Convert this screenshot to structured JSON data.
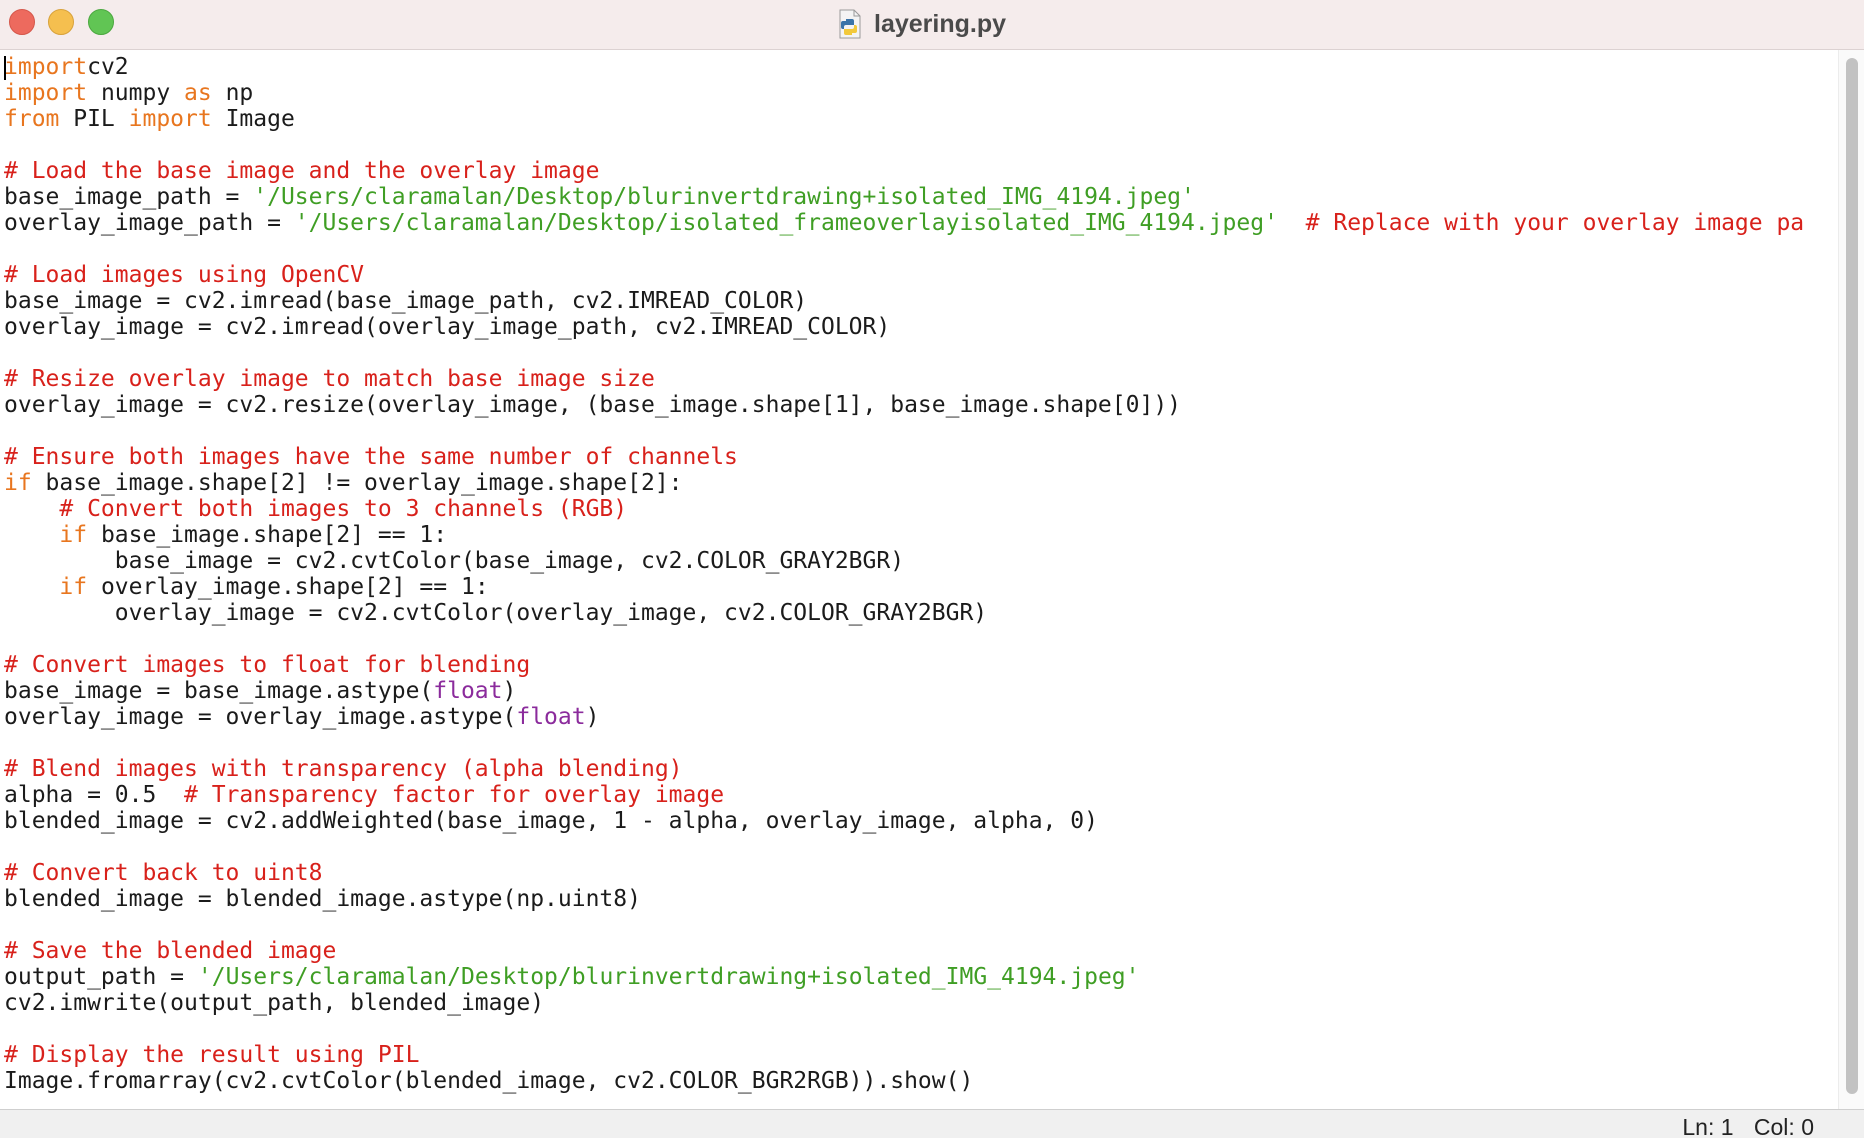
{
  "window": {
    "title": "layering.py",
    "file_icon": "python-file-icon"
  },
  "editor": {
    "lines": [
      [
        [
          "kw",
          "import"
        ],
        [
          "",
          "cv2"
        ]
      ],
      [
        [
          "kw",
          "import"
        ],
        [
          "",
          " numpy "
        ],
        [
          "kw",
          "as"
        ],
        [
          "",
          " np"
        ]
      ],
      [
        [
          "kw",
          "from"
        ],
        [
          "",
          " PIL "
        ],
        [
          "kw",
          "import"
        ],
        [
          "",
          " Image"
        ]
      ],
      [],
      [
        [
          "cm",
          "# Load the base image and the overlay image"
        ]
      ],
      [
        [
          "",
          "base_image_path = "
        ],
        [
          "st",
          "'/Users/claramalan/Desktop/blurinvertdrawing+isolated_IMG_4194.jpeg'"
        ]
      ],
      [
        [
          "",
          "overlay_image_path = "
        ],
        [
          "st",
          "'/Users/claramalan/Desktop/isolated_frameoverlayisolated_IMG_4194.jpeg'"
        ],
        [
          "",
          "  "
        ],
        [
          "cm",
          "# Replace with your overlay image pa"
        ]
      ],
      [],
      [
        [
          "cm",
          "# Load images using OpenCV"
        ]
      ],
      [
        [
          "",
          "base_image = cv2.imread(base_image_path, cv2.IMREAD_COLOR)"
        ]
      ],
      [
        [
          "",
          "overlay_image = cv2.imread(overlay_image_path, cv2.IMREAD_COLOR)"
        ]
      ],
      [],
      [
        [
          "cm",
          "# Resize overlay image to match base image size"
        ]
      ],
      [
        [
          "",
          "overlay_image = cv2.resize(overlay_image, (base_image.shape[1], base_image.shape[0]))"
        ]
      ],
      [],
      [
        [
          "cm",
          "# Ensure both images have the same number of channels"
        ]
      ],
      [
        [
          "kw",
          "if"
        ],
        [
          "",
          " base_image.shape[2] != overlay_image.shape[2]:"
        ]
      ],
      [
        [
          "",
          "    "
        ],
        [
          "cm",
          "# Convert both images to 3 channels (RGB)"
        ]
      ],
      [
        [
          "",
          "    "
        ],
        [
          "kw",
          "if"
        ],
        [
          "",
          " base_image.shape[2] == 1:"
        ]
      ],
      [
        [
          "",
          "        base_image = cv2.cvtColor(base_image, cv2.COLOR_GRAY2BGR)"
        ]
      ],
      [
        [
          "",
          "    "
        ],
        [
          "kw",
          "if"
        ],
        [
          "",
          " overlay_image.shape[2] == 1:"
        ]
      ],
      [
        [
          "",
          "        overlay_image = cv2.cvtColor(overlay_image, cv2.COLOR_GRAY2BGR)"
        ]
      ],
      [],
      [
        [
          "cm",
          "# Convert images to float for blending"
        ]
      ],
      [
        [
          "",
          "base_image = base_image.astype("
        ],
        [
          "bi",
          "float"
        ],
        [
          "",
          ")"
        ]
      ],
      [
        [
          "",
          "overlay_image = overlay_image.astype("
        ],
        [
          "bi",
          "float"
        ],
        [
          "",
          ")"
        ]
      ],
      [],
      [
        [
          "cm",
          "# Blend images with transparency (alpha blending)"
        ]
      ],
      [
        [
          "",
          "alpha = 0.5  "
        ],
        [
          "cm",
          "# Transparency factor for overlay image"
        ]
      ],
      [
        [
          "",
          "blended_image = cv2.addWeighted(base_image, 1 - alpha, overlay_image, alpha, 0)"
        ]
      ],
      [],
      [
        [
          "cm",
          "# Convert back to uint8"
        ]
      ],
      [
        [
          "",
          "blended_image = blended_image.astype(np.uint8)"
        ]
      ],
      [],
      [
        [
          "cm",
          "# Save the blended image"
        ]
      ],
      [
        [
          "",
          "output_path = "
        ],
        [
          "st",
          "'/Users/claramalan/Desktop/blurinvertdrawing+isolated_IMG_4194.jpeg'"
        ]
      ],
      [
        [
          "",
          "cv2.imwrite(output_path, blended_image)"
        ]
      ],
      [],
      [
        [
          "cm",
          "# Display the result using PIL"
        ]
      ],
      [
        [
          "",
          "Image.fromarray(cv2.cvtColor(blended_image, cv2.COLOR_BGR2RGB)).show()"
        ]
      ]
    ]
  },
  "status": {
    "line": "Ln: 1",
    "col": "Col: 0"
  },
  "colors": {
    "keyword": "#e8761f",
    "comment": "#d8211b",
    "string": "#3f9e24",
    "builtin": "#8b2b9c",
    "titlebar": "#f5ecec"
  }
}
